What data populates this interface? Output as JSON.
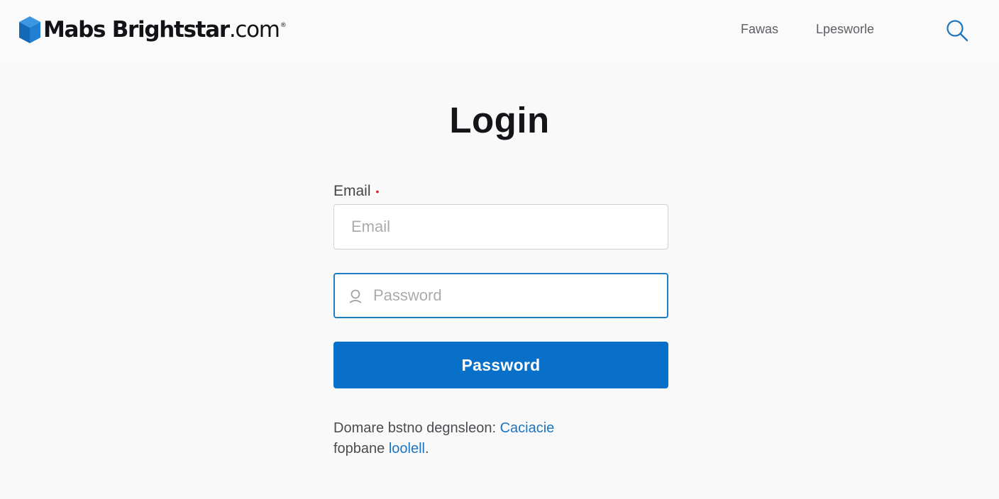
{
  "header": {
    "brand_bold": "Mabs Brightstar",
    "brand_suffix": ".com",
    "brand_mark": "®",
    "nav": [
      "Fawas",
      "Lpesworle"
    ]
  },
  "icons": {
    "logo": "cube-logo-icon",
    "search": "search-icon",
    "password_field": "user-icon"
  },
  "login": {
    "title": "Login",
    "email_label": "Email",
    "required_marker": "•",
    "email_placeholder": "Email",
    "password_placeholder": "Password",
    "submit_label": "Password"
  },
  "footer": {
    "line1_text": "Domare bstno degnsleon: ",
    "line1_link": "Caciacie",
    "line2_text": "fopbane ",
    "line2_link": "loolell",
    "line2_end": "."
  },
  "colors": {
    "accent": "#0870c8",
    "link": "#1e75bf",
    "focus_border": "#1f7fc4",
    "required": "#d9211f",
    "logo_blue": "#1775c8"
  }
}
